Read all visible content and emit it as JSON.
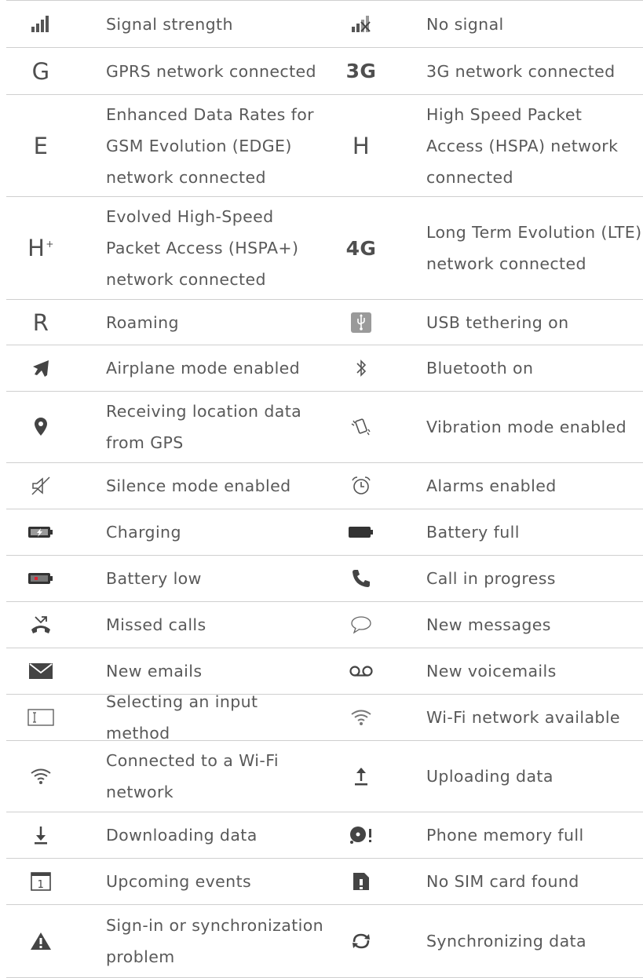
{
  "rows": [
    {
      "h": 60,
      "left": {
        "icon": "signal-strength-icon",
        "label": "Signal strength"
      },
      "right": {
        "icon": "no-signal-icon",
        "label": "No signal"
      }
    },
    {
      "h": 60,
      "left": {
        "icon": "gprs-icon",
        "glyph": "G",
        "label": "GPRS network connected"
      },
      "right": {
        "icon": "3g-icon",
        "glyph": "3G",
        "label": "3G network connected"
      }
    },
    {
      "h": 130,
      "left": {
        "icon": "edge-icon",
        "glyph": "E",
        "label": "Enhanced Data Rates for GSM Evolution (EDGE) network connected"
      },
      "right": {
        "icon": "hspa-icon",
        "glyph": "H",
        "label": "High Speed Packet Access (HSPA) network connected"
      }
    },
    {
      "h": 131,
      "left": {
        "icon": "hspa-plus-icon",
        "glyph": "H",
        "glyph_sup": "+",
        "label": "Evolved High-Speed Packet Access (HSPA+) network connected"
      },
      "right": {
        "icon": "4g-icon",
        "glyph": "4G",
        "label": "Long Term Evolution (LTE) network connected"
      }
    },
    {
      "h": 58,
      "left": {
        "icon": "roaming-icon",
        "glyph": "R",
        "label": "Roaming"
      },
      "right": {
        "icon": "usb-tethering-icon",
        "label": "USB tethering on"
      }
    },
    {
      "h": 59,
      "left": {
        "icon": "airplane-icon",
        "label": "Airplane mode enabled"
      },
      "right": {
        "icon": "bluetooth-icon",
        "label": "Bluetooth on"
      }
    },
    {
      "h": 91,
      "left": {
        "icon": "location-pin-icon",
        "label": "Receiving location data from GPS"
      },
      "right": {
        "icon": "vibration-icon",
        "label": "Vibration mode enabled"
      }
    },
    {
      "h": 59,
      "left": {
        "icon": "silence-icon",
        "label": "Silence mode enabled"
      },
      "right": {
        "icon": "alarm-clock-icon",
        "label": "Alarms enabled"
      }
    },
    {
      "h": 59,
      "left": {
        "icon": "battery-charging-icon",
        "label": "Charging"
      },
      "right": {
        "icon": "battery-full-icon",
        "label": "Battery full"
      }
    },
    {
      "h": 59,
      "left": {
        "icon": "battery-low-icon",
        "label": "Battery low"
      },
      "right": {
        "icon": "phone-call-icon",
        "label": "Call in progress"
      }
    },
    {
      "h": 59,
      "left": {
        "icon": "missed-call-icon",
        "label": "Missed calls"
      },
      "right": {
        "icon": "message-bubble-icon",
        "label": "New messages"
      }
    },
    {
      "h": 59,
      "left": {
        "icon": "email-envelope-icon",
        "label": "New emails"
      },
      "right": {
        "icon": "voicemail-icon",
        "label": "New voicemails"
      }
    },
    {
      "h": 59,
      "left": {
        "icon": "keyboard-input-icon",
        "label": "Selecting an input method"
      },
      "right": {
        "icon": "wifi-available-icon",
        "label": "Wi-Fi network available"
      }
    },
    {
      "h": 91,
      "left": {
        "icon": "wifi-connected-icon",
        "label": "Connected to a Wi-Fi network"
      },
      "right": {
        "icon": "upload-icon",
        "label": "Uploading data"
      }
    },
    {
      "h": 59,
      "left": {
        "icon": "download-icon",
        "label": "Downloading data"
      },
      "right": {
        "icon": "memory-full-icon",
        "label": "Phone memory full"
      }
    },
    {
      "h": 59,
      "left": {
        "icon": "calendar-icon",
        "glyph": "1",
        "label": "Upcoming events"
      },
      "right": {
        "icon": "no-sim-icon",
        "label": "No SIM card found"
      }
    },
    {
      "h": 93,
      "left": {
        "icon": "warning-icon",
        "label": "Sign-in or synchronization problem"
      },
      "right": {
        "icon": "sync-icon",
        "label": "Synchronizing data"
      }
    }
  ]
}
